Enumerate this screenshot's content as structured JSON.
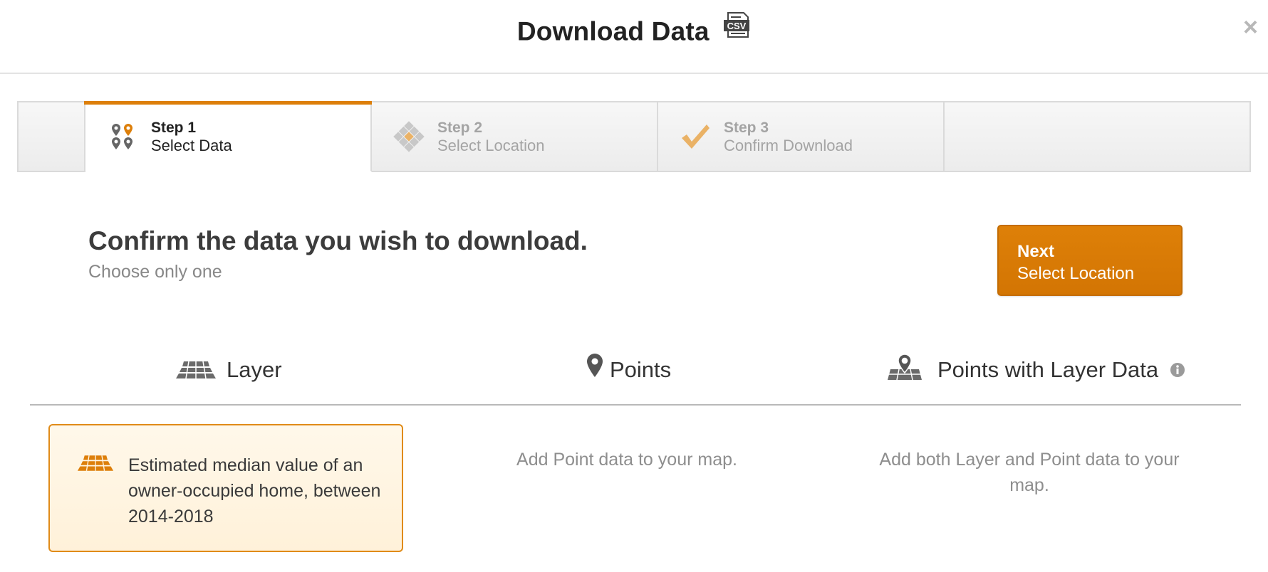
{
  "header": {
    "title": "Download Data",
    "csv_badge": "CSV",
    "close_label": "×"
  },
  "steps": [
    {
      "num": "Step 1",
      "label": "Select Data",
      "state": "active"
    },
    {
      "num": "Step 2",
      "label": "Select Location",
      "state": "inactive"
    },
    {
      "num": "Step 3",
      "label": "Confirm Download",
      "state": "inactive"
    }
  ],
  "main": {
    "headline": "Confirm the data you wish to download.",
    "subline": "Choose only one",
    "next_button": {
      "line1": "Next",
      "line2": "Select Location"
    }
  },
  "types": [
    {
      "label": "Layer",
      "icon": "layer-icon",
      "selected": true
    },
    {
      "label": "Points",
      "icon": "map-pin-icon",
      "selected": false
    },
    {
      "label": "Points with Layer Data",
      "icon": "pin-on-map-icon",
      "selected": false
    }
  ],
  "content": {
    "layer_card": "Estimated median value of an owner-occupied home, between 2014-2018",
    "points_desc": "Add Point data to your map.",
    "pwld_desc": "Add both Layer and Point data to your map."
  },
  "colors": {
    "accent": "#dd7f0a",
    "card_border": "#e08b18",
    "card_bg": "#fff4e0",
    "muted_text": "#8e8e8e"
  }
}
